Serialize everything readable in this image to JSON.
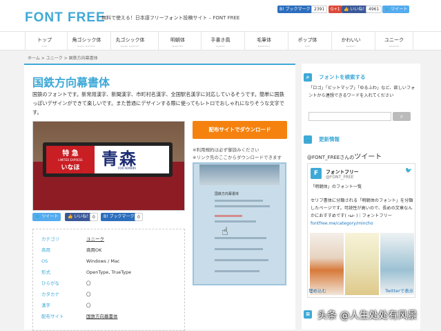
{
  "header": {
    "logo": "FONT FREE",
    "tagline": "無料で使える！日本語フリーフォント投稿サイト – FONT FREE",
    "hatena_label": "ブックマーク",
    "hatena_count": "2391",
    "gplus_label": "G+1",
    "fb_label": "いいね！",
    "fb_count": "4961",
    "tweet_label": "ツイート",
    "colors": {
      "accent": "#3ea9d6",
      "hatena": "#2c6ebd",
      "gplus": "#db4a39",
      "facebook": "#3b5998",
      "twitter": "#55acee"
    }
  },
  "nav": {
    "items": [
      {
        "label": "トップ",
        "sub": "TOP"
      },
      {
        "label": "角ゴシック体",
        "sub": "KAKU GOTHIC"
      },
      {
        "label": "丸ゴシック体",
        "sub": "MARU GOTHIC"
      },
      {
        "label": "明朝体",
        "sub": "MINCHO"
      },
      {
        "label": "手書き風",
        "sub": "SCRIPT"
      },
      {
        "label": "毛筆体",
        "sub": "MOHITSU"
      },
      {
        "label": "ポップ体",
        "sub": "POP"
      },
      {
        "label": "かわいい",
        "sub": "KAWAII"
      },
      {
        "label": "ユニーク",
        "sub": "UNIQUE"
      }
    ]
  },
  "breadcrumb": [
    "ホーム",
    ">",
    "ユニーク",
    ">",
    "国鉄方向幕書体"
  ],
  "article": {
    "title": "国鉄方向幕書体",
    "description": "国鉄のフォントです。新常用漢字、新聞漢字、市町村名漢字、全国駅名漢字に対応しているそうです。簡単に国鉄っぽいデザインができて楽しいです。また普通にデザインする際に使ってもレトロでおしゃれになりそうな文字です。",
    "hero_sign": {
      "line1": "特 急",
      "line2": "LIMITED EXPRESS",
      "line3": "いなほ",
      "line4": "青森",
      "line5": "FOR AOMORI"
    },
    "download_button": "配布サイトでダウンロード",
    "note1": "※利用規約は必ず御読みください",
    "note2": "※リンク先のここからダウンロードできます",
    "preview_title": "国鉄方向幕書体",
    "share": {
      "tweet": "ツイート",
      "like": "いいね！",
      "like_count": "0",
      "hatena": "ブックマーク",
      "hatena_count": "0"
    },
    "info": [
      {
        "key": "カテゴリ",
        "value": "ユニーク",
        "link": true
      },
      {
        "key": "商用",
        "value": "商用OK",
        "link": false
      },
      {
        "key": "OS",
        "value": "Windows / Mac",
        "link": false
      },
      {
        "key": "形式",
        "value": "OpenType, TrueType",
        "link": false
      },
      {
        "key": "ひらがな",
        "value": "〇",
        "link": false
      },
      {
        "key": "カタカナ",
        "value": "〇",
        "link": false
      },
      {
        "key": "漢字",
        "value": "〇",
        "link": false
      },
      {
        "key": "配布サイト",
        "value": "国鉄方向幕書体",
        "link": true
      }
    ]
  },
  "sidebar": {
    "search_heading": "フォントを検索する",
    "search_desc": "「ロゴ」「ビットマップ」「ゆるふわ」など、欲しいフォントから連想できるワードを入れてください",
    "search_placeholder": "",
    "update_heading": "更新情報",
    "tweets_heading_prefix": "@FONT_FREEさんの",
    "tweets_heading": "ツイート",
    "tweet": {
      "avatar": "F",
      "name": "フォントフリー",
      "handle": "@FONT_FREE",
      "line1": "「明朝体」のフォント一覧",
      "body": "セリフ書体に分類される「明朝体のフォント」を分類したページです。可読性が高いので、長めの文章なんかにおすすめです( ›ω‹ )｜フォントフリー ",
      "link": "fontfree.me/category/mincho"
    },
    "embed_label": "埋め込む",
    "view_label": "Twitterで表示"
  },
  "watermark": "头条 @人生处处有风景"
}
